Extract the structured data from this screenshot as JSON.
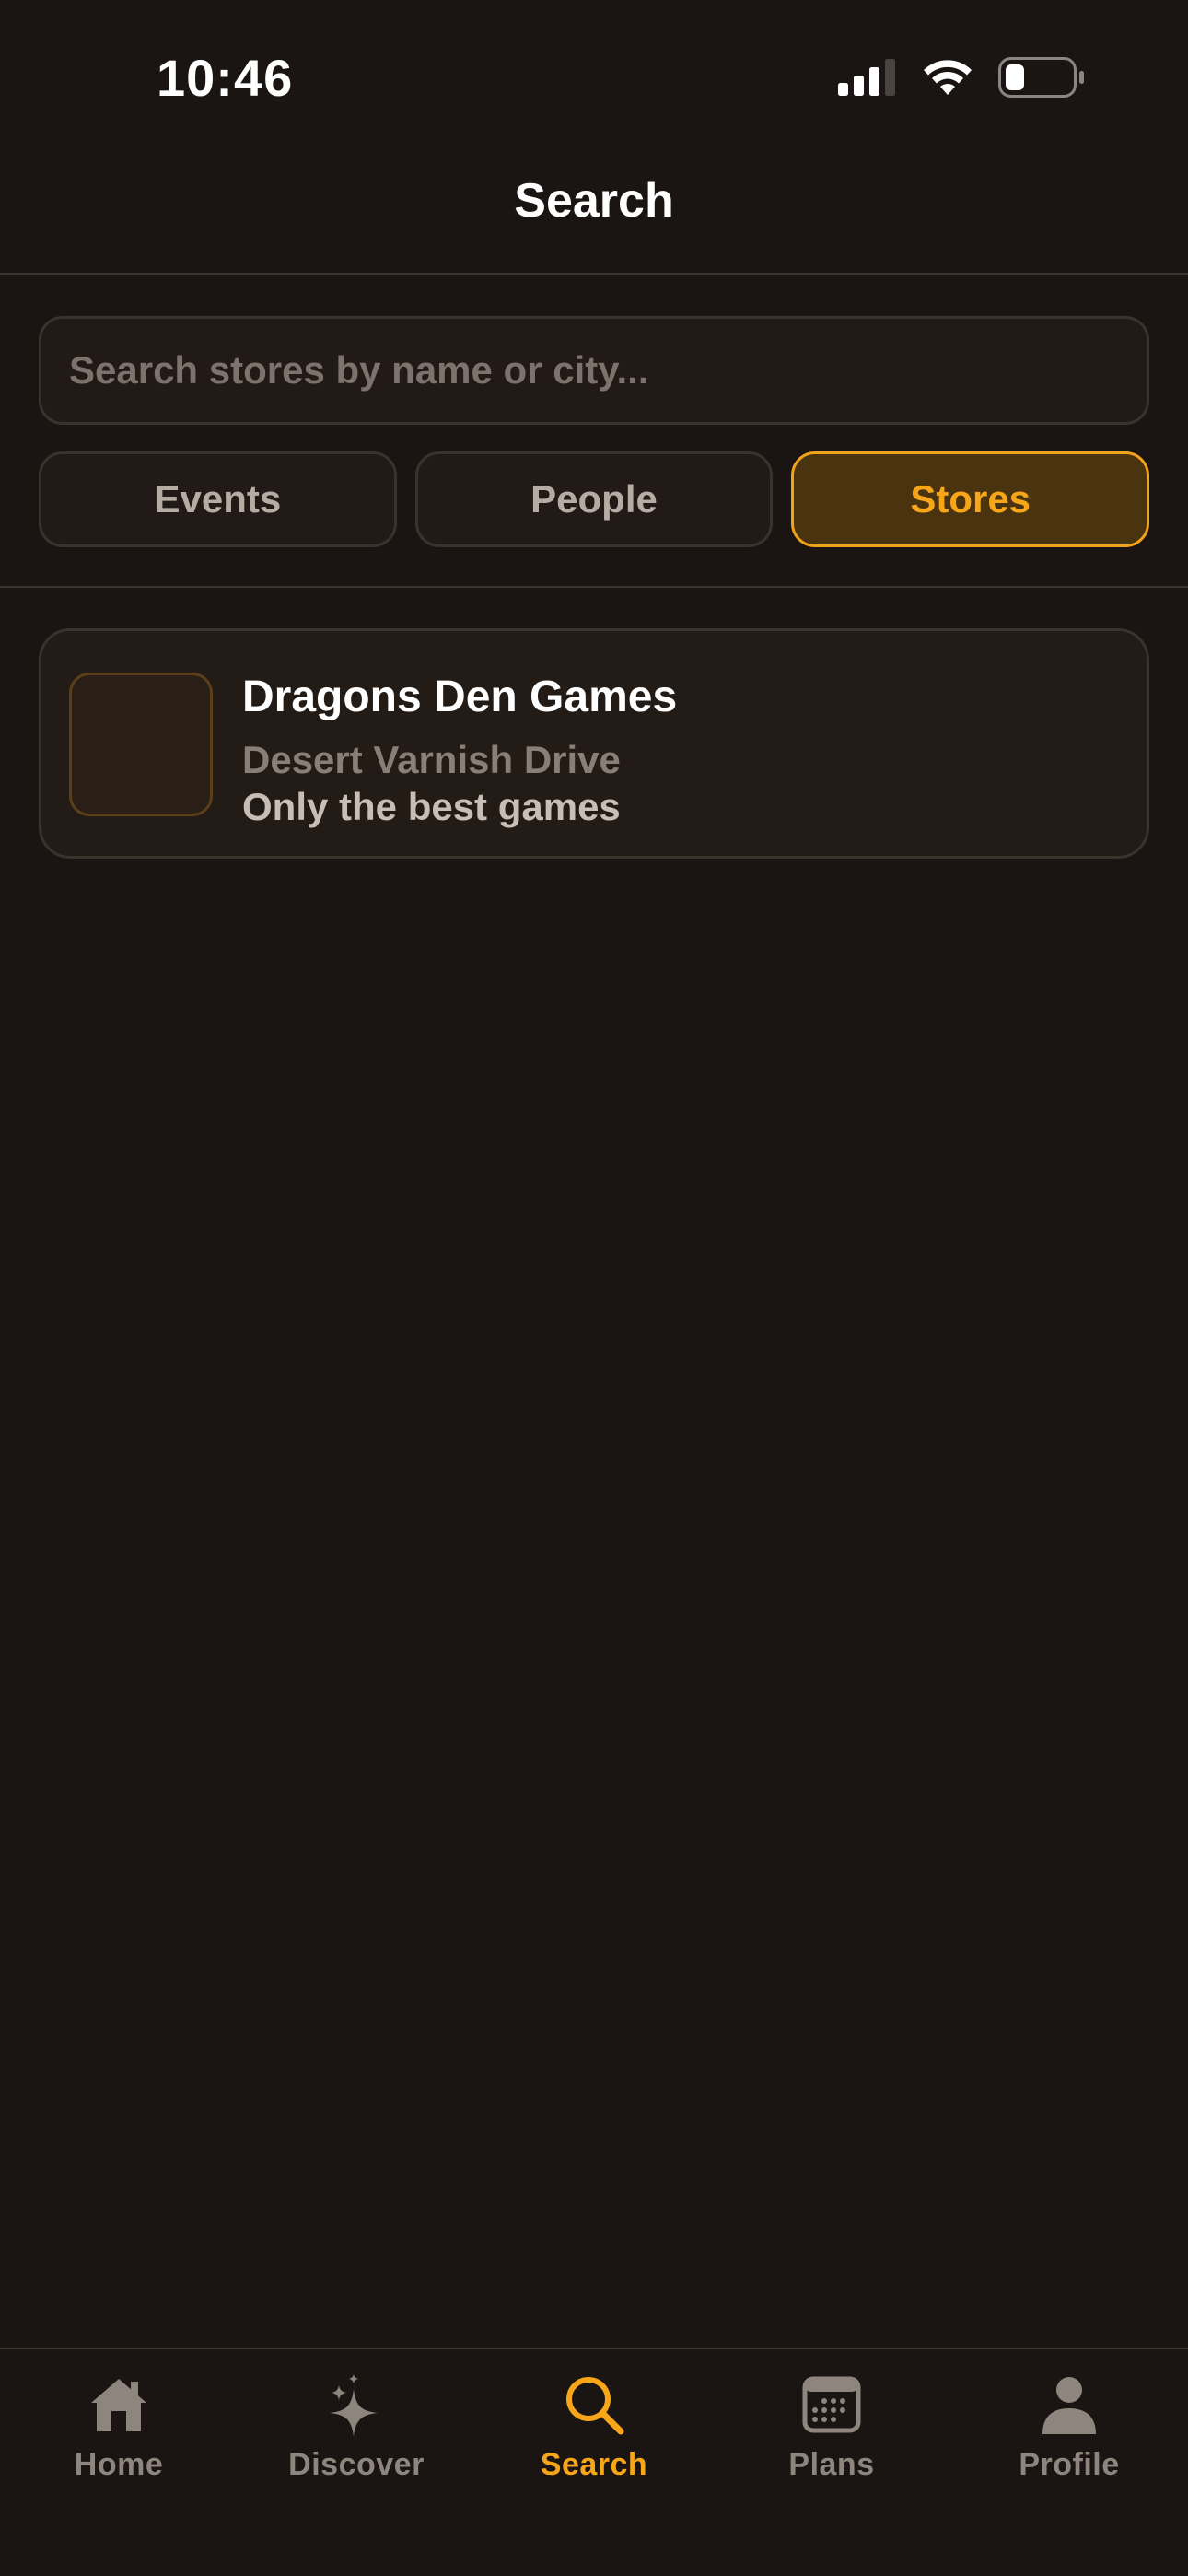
{
  "status_bar": {
    "time": "10:46"
  },
  "header": {
    "title": "Search"
  },
  "search": {
    "placeholder": "Search stores by name or city...",
    "value": ""
  },
  "tabs": [
    {
      "label": "Events",
      "active": false
    },
    {
      "label": "People",
      "active": false
    },
    {
      "label": "Stores",
      "active": true
    }
  ],
  "results": [
    {
      "name": "Dragons Den Games",
      "address": "Desert Varnish Drive",
      "description": "Only the best games"
    }
  ],
  "bottom_nav": [
    {
      "label": "Home",
      "icon": "home-icon",
      "active": false
    },
    {
      "label": "Discover",
      "icon": "sparkles-icon",
      "active": false
    },
    {
      "label": "Search",
      "icon": "search-icon",
      "active": true
    },
    {
      "label": "Plans",
      "icon": "calendar-icon",
      "active": false
    },
    {
      "label": "Profile",
      "icon": "person-icon",
      "active": false
    }
  ],
  "colors": {
    "background": "#1a1512",
    "accent": "#f7a519",
    "accent_bg": "#4a330f",
    "muted_text": "#8e857e"
  }
}
